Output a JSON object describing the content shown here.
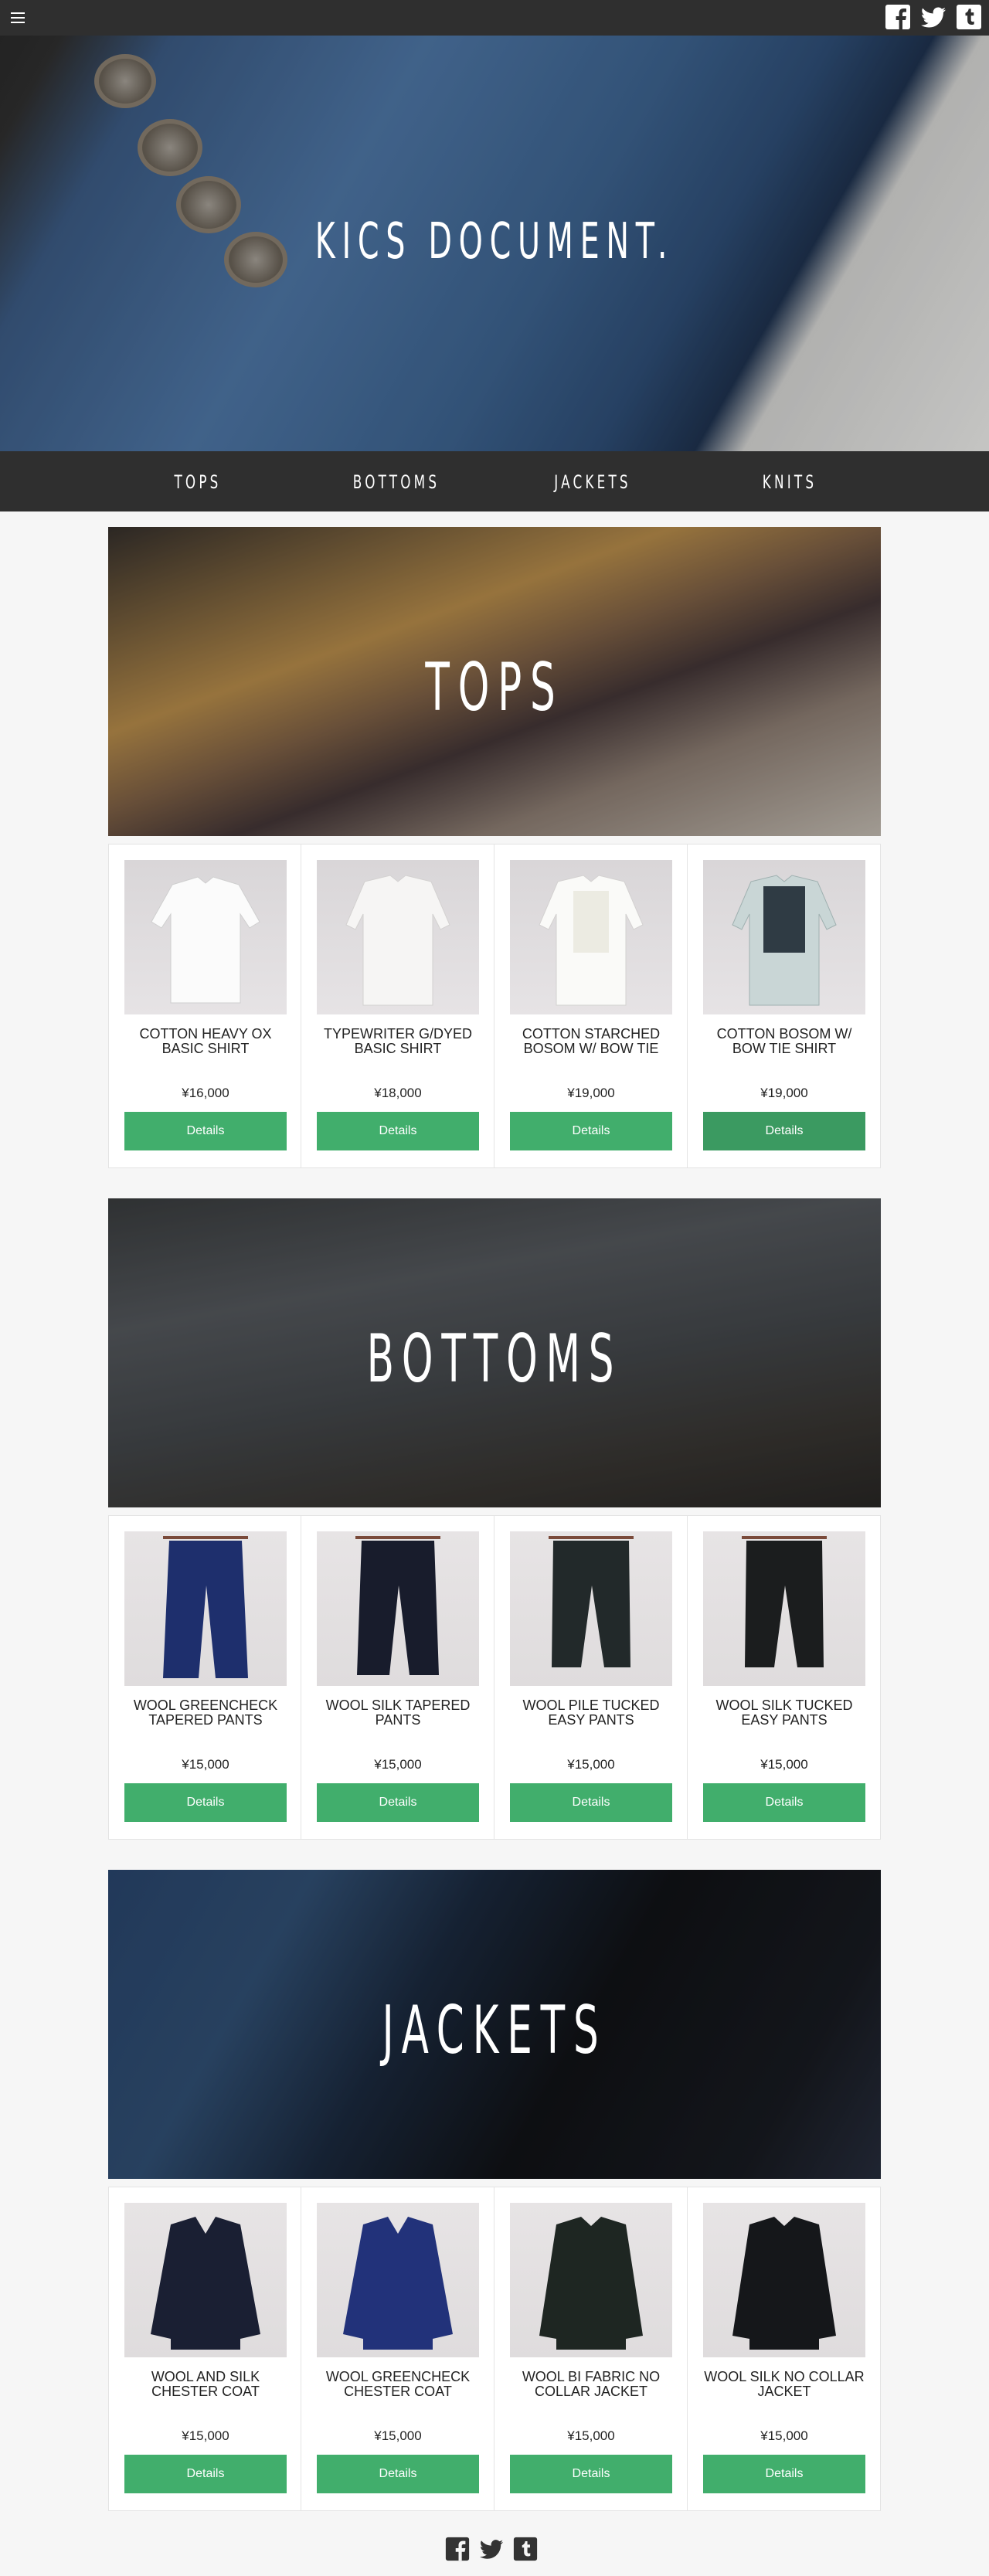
{
  "header": {
    "menu_icon": "hamburger-icon",
    "social": [
      "facebook-icon",
      "twitter-icon",
      "tumblr-icon"
    ]
  },
  "hero": {
    "title": "KICS DOCUMENT."
  },
  "nav": {
    "items": [
      "TOPS",
      "BOTTOMS",
      "JACKETS",
      "KNITS"
    ]
  },
  "sections": [
    {
      "title": "TOPS",
      "products": [
        {
          "name": "COTTON HEAVY OX BASIC SHIRT",
          "price": "¥16,000",
          "button": "Details"
        },
        {
          "name": "TYPEWRITER G/DYED BASIC SHIRT",
          "price": "¥18,000",
          "button": "Details"
        },
        {
          "name": "COTTON STARCHED BOSOM W/ BOW TIE",
          "price": "¥19,000",
          "button": "Details"
        },
        {
          "name": "COTTON BOSOM W/ BOW TIE SHIRT",
          "price": "¥19,000",
          "button": "Details"
        }
      ]
    },
    {
      "title": "BOTTOMS",
      "products": [
        {
          "name": "WOOL GREENCHECK TAPERED PANTS",
          "price": "¥15,000",
          "button": "Details"
        },
        {
          "name": "WOOL SILK TAPERED PANTS",
          "price": "¥15,000",
          "button": "Details"
        },
        {
          "name": "WOOL PILE TUCKED EASY PANTS",
          "price": "¥15,000",
          "button": "Details"
        },
        {
          "name": "WOOL SILK TUCKED EASY PANTS",
          "price": "¥15,000",
          "button": "Details"
        }
      ]
    },
    {
      "title": "JACKETS",
      "products": [
        {
          "name": "WOOL AND SILK CHESTER COAT",
          "price": "¥15,000",
          "button": "Details"
        },
        {
          "name": "WOOL GREENCHECK CHESTER COAT",
          "price": "¥15,000",
          "button": "Details"
        },
        {
          "name": "WOOL BI FABRIC NO COLLAR JACKET",
          "price": "¥15,000",
          "button": "Details"
        },
        {
          "name": "WOOL SILK NO COLLAR JACKET",
          "price": "¥15,000",
          "button": "Details"
        }
      ]
    }
  ],
  "footer": {
    "social": [
      "facebook-icon",
      "twitter-icon",
      "tumblr-icon"
    ]
  },
  "colors": {
    "accent": "#41ae6c",
    "bar": "#2f2f2f",
    "background": "#f6f6f6"
  }
}
